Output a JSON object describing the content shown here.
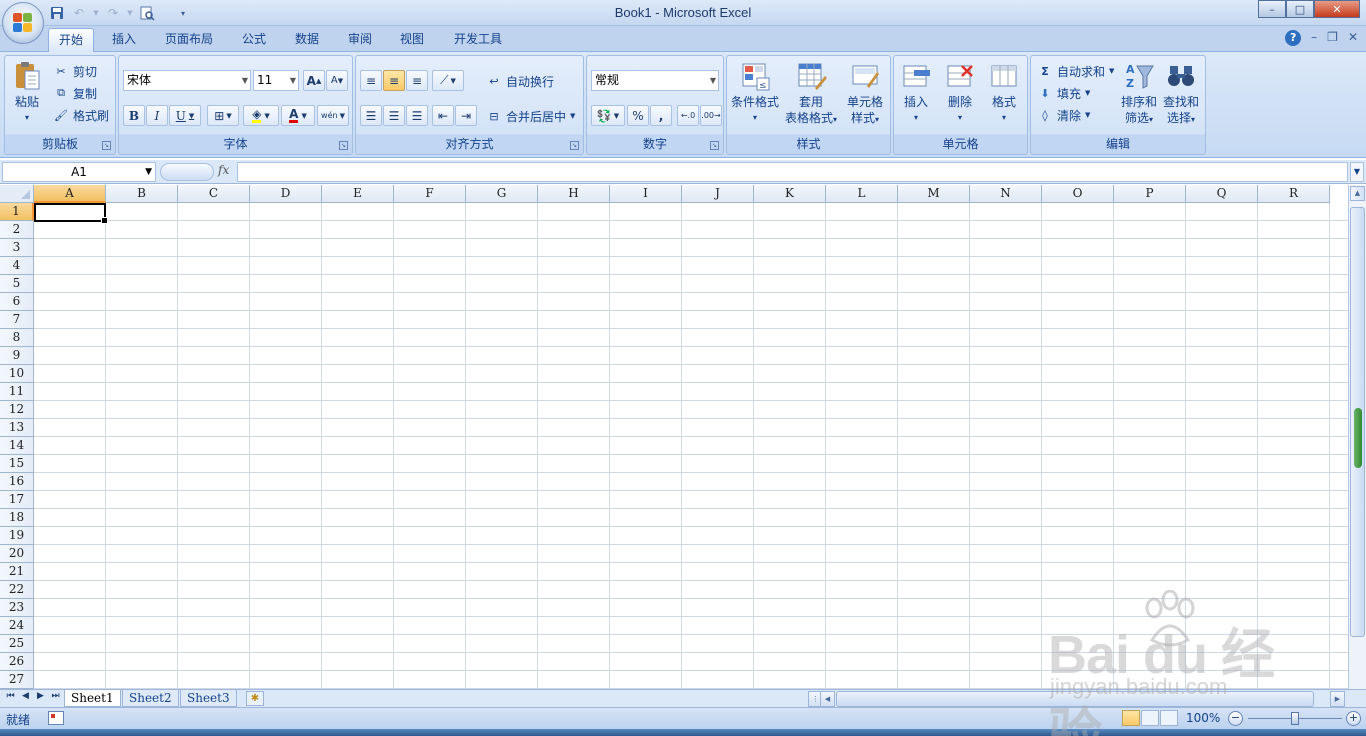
{
  "window": {
    "title": "Book1 - Microsoft Excel",
    "controls": {
      "minimize": "–",
      "maximize": "□",
      "close": "✕"
    }
  },
  "quick_access": [
    "save-icon",
    "undo-icon",
    "redo-icon",
    "print-preview-icon",
    "customize-icon"
  ],
  "tabs": [
    {
      "label": "开始",
      "active": true
    },
    {
      "label": "插入"
    },
    {
      "label": "页面布局"
    },
    {
      "label": "公式"
    },
    {
      "label": "数据"
    },
    {
      "label": "审阅"
    },
    {
      "label": "视图"
    },
    {
      "label": "开发工具"
    }
  ],
  "ribbon": {
    "clipboard": {
      "label": "剪贴板",
      "paste": "粘贴",
      "cut": "剪切",
      "copy": "复制",
      "format_painter": "格式刷"
    },
    "font": {
      "label": "字体",
      "font_name": "宋体",
      "font_size": "11",
      "grow": "A",
      "shrink": "A",
      "bold": "B",
      "italic": "I",
      "underline": "U",
      "phonetic": "wén"
    },
    "alignment": {
      "label": "对齐方式",
      "wrap_text": "自动换行",
      "merge_center": "合并后居中"
    },
    "number": {
      "label": "数字",
      "format": "常规",
      "percent": "%",
      "comma": ","
    },
    "styles": {
      "label": "样式",
      "conditional": "条件格式",
      "table_line1": "套用",
      "table_line2": "表格格式",
      "cell_style_line1": "单元格",
      "cell_style_line2": "样式"
    },
    "cells": {
      "label": "单元格",
      "insert": "插入",
      "delete": "删除",
      "format": "格式"
    },
    "editing": {
      "label": "编辑",
      "autosum": "自动求和",
      "fill": "填充",
      "clear": "清除",
      "sort_line1": "排序和",
      "sort_line2": "筛选",
      "find_line1": "查找和",
      "find_line2": "选择"
    }
  },
  "formula_bar": {
    "name_box": "A1",
    "fx": "fx",
    "value": ""
  },
  "grid": {
    "columns": [
      "A",
      "B",
      "C",
      "D",
      "E",
      "F",
      "G",
      "H",
      "I",
      "J",
      "K",
      "L",
      "M",
      "N",
      "O",
      "P",
      "Q",
      "R"
    ],
    "rows": [
      "1",
      "2",
      "3",
      "4",
      "5",
      "6",
      "7",
      "8",
      "9",
      "10",
      "11",
      "12",
      "13",
      "14",
      "15",
      "16",
      "17",
      "18",
      "19",
      "20",
      "21",
      "22",
      "23",
      "24",
      "25",
      "26",
      "27"
    ],
    "active_cell": "A1"
  },
  "sheets": [
    {
      "label": "Sheet1",
      "active": true
    },
    {
      "label": "Sheet2"
    },
    {
      "label": "Sheet3"
    }
  ],
  "status": {
    "ready": "就绪",
    "zoom": "100%",
    "zoom_level": 0.5
  },
  "watermark": {
    "brand": "Bai du 经验",
    "url": "jingyan.baidu.com"
  },
  "colors": {
    "accent": "#15428b",
    "active_header": "#f1c15f",
    "gridline": "#d0d7e5"
  }
}
